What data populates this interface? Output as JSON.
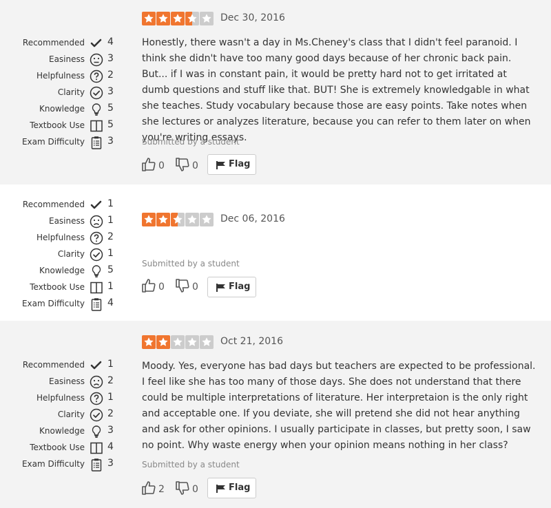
{
  "reviews": [
    {
      "metrics": [
        {
          "label": "Recommended",
          "value": "4",
          "icon": "checkmark-icon"
        },
        {
          "label": "Easiness",
          "value": "3",
          "icon": "neutral-face-icon"
        },
        {
          "label": "Helpfulness",
          "value": "2",
          "icon": "question-circle-icon"
        },
        {
          "label": "Clarity",
          "value": "3",
          "icon": "check-circle-icon"
        },
        {
          "label": "Knowledge",
          "value": "5",
          "icon": "lightbulb-icon"
        },
        {
          "label": "Textbook Use",
          "value": "5",
          "icon": "book-icon"
        },
        {
          "label": "Exam Difficulty",
          "value": "3",
          "icon": "clipboard-icon"
        }
      ],
      "rating": 3.5,
      "date": "Dec 30, 2016",
      "comment": "Honestly, there wasn't a day in Ms.Cheney's class that I didn't feel paranoid. I think she didn't have too many good days because of her chronic back pain. But... if I was in constant pain, it would be pretty hard not to get irritated at dumb questions and stuff like that. BUT! She is extremely knowledgable in what she teaches. Study vocabulary because those are easy points. Take notes when she lectures or analyzes literature, because you can refer to them later on when you're writing essays.",
      "submitted": "Submitted by a student",
      "thumbs_up": "0",
      "thumbs_down": "0",
      "flag_label": "Flag"
    },
    {
      "metrics": [
        {
          "label": "Recommended",
          "value": "1",
          "icon": "checkmark-icon"
        },
        {
          "label": "Easiness",
          "value": "1",
          "icon": "sad-face-icon"
        },
        {
          "label": "Helpfulness",
          "value": "2",
          "icon": "question-circle-icon"
        },
        {
          "label": "Clarity",
          "value": "1",
          "icon": "check-circle-icon"
        },
        {
          "label": "Knowledge",
          "value": "5",
          "icon": "lightbulb-icon"
        },
        {
          "label": "Textbook Use",
          "value": "1",
          "icon": "book-icon"
        },
        {
          "label": "Exam Difficulty",
          "value": "4",
          "icon": "clipboard-icon"
        }
      ],
      "rating": 2.5,
      "date": "Dec 06, 2016",
      "comment": "",
      "submitted": "Submitted by a student",
      "thumbs_up": "0",
      "thumbs_down": "0",
      "flag_label": "Flag"
    },
    {
      "metrics": [
        {
          "label": "Recommended",
          "value": "1",
          "icon": "checkmark-icon"
        },
        {
          "label": "Easiness",
          "value": "2",
          "icon": "sad-face-icon"
        },
        {
          "label": "Helpfulness",
          "value": "1",
          "icon": "question-circle-icon"
        },
        {
          "label": "Clarity",
          "value": "2",
          "icon": "check-circle-icon"
        },
        {
          "label": "Knowledge",
          "value": "3",
          "icon": "lightbulb-icon"
        },
        {
          "label": "Textbook Use",
          "value": "4",
          "icon": "book-icon"
        },
        {
          "label": "Exam Difficulty",
          "value": "3",
          "icon": "clipboard-icon"
        }
      ],
      "rating": 2,
      "date": "Oct 21, 2016",
      "comment": "Moody. Yes, everyone has bad days but teachers are expected to be professional. I feel like she has too many of those days. She does not understand that there could be multiple interpretations of literature. Her interpretaion is the only right and acceptable one. If you deviate, she will pretend she did not hear anything and ask for other opinions. I usually participate in classes, but pretty soon, I saw no point. Why waste energy when your opinion means nothing in her class?",
      "submitted": "Submitted by a student",
      "thumbs_up": "2",
      "thumbs_down": "0",
      "flag_label": "Flag"
    }
  ],
  "colors": {
    "star_filled": "#f0752f",
    "star_empty": "#cccccc",
    "band_gray": "#f3f3f3"
  }
}
